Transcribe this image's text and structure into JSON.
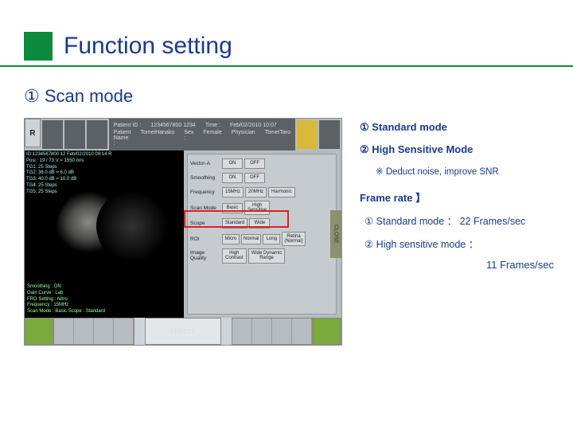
{
  "title": "Function setting",
  "subtitle": "① Scan mode",
  "screenshot": {
    "top": {
      "logo": "R",
      "patient_id_label": "Patient ID :",
      "patient_id": "1234567800 1234",
      "time_label": "Time :",
      "time": "Feb/02/2010    10:07",
      "name_label": "Patient Name :",
      "name": "TomeiHanako",
      "sex_label": "Sex :",
      "sex": "Female",
      "physician_label": "Physician",
      "physician": "TomeiTaro"
    },
    "us_readout": {
      "l1": "ID:1234567800 12 Feb/02/2010 09:14 R",
      "l2": "Posi : 19 / 73  V = 1550 m/s",
      "l3": "TG1: 25 Steps",
      "l4": "TG2: 36.0 dB = 6.0 dB",
      "l5": "TG3: 40.0 dB = 10.0 dB",
      "l6": "TG4: 25 Steps",
      "l7": "TG5: 25 Steps"
    },
    "us_readout2": {
      "l1": "Smoothing    : ON",
      "l2": "Gain Curve   : Lab",
      "l3": "FRG Setting  : Nitro",
      "l4": "Frequency    : 15MHz",
      "l5": "Scan Mode    : Basic  Scope  : Standard"
    },
    "panel": {
      "vectorA": "Vector-A",
      "on": "ON",
      "off": "OFF",
      "smoothing": "Smoothing",
      "frequency": "Frequency",
      "f15": "15MHz",
      "f20": "20MHz",
      "harmonic": "Harmonic",
      "scanmode": "Scan Mode",
      "basic": "Basic",
      "highsens": "High\nSensitive",
      "scope": "Scope",
      "standard": "Standard",
      "wide": "Wide",
      "roi": "ROI",
      "micro": "Micro",
      "normal": "Normal",
      "long": "Long",
      "retina": "Retina\n(Normal)",
      "imgq": "Image Quality",
      "highcon": "High\nContrast",
      "widedr": "Wide Dynamic\nRange"
    },
    "close": "CLOSE",
    "freeze": "FREEZE"
  },
  "sidebar": {
    "l1": "①  Standard mode",
    "l2": "②  High Sensitive Mode",
    "l2sub": "※ Deduct noise, improve SNR",
    "fr_title": "Frame rate 】",
    "fr1": "① Standard mode ： 22 Frames/sec",
    "fr2": "② High sensitive mode ：",
    "fr2val": "11 Frames/sec"
  }
}
